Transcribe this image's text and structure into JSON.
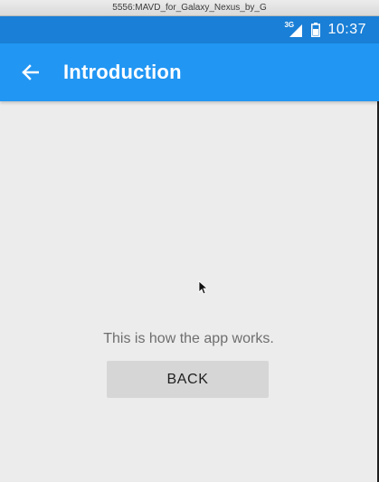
{
  "window": {
    "title": "5556:MAVD_for_Galaxy_Nexus_by_G"
  },
  "statusbar": {
    "network_label": "3G",
    "clock": "10:37",
    "icons": [
      "signal-icon",
      "battery-icon"
    ]
  },
  "appbar": {
    "title": "Introduction",
    "back_icon": "arrow-left-icon"
  },
  "content": {
    "message": "This is how the app works.",
    "button_label": "BACK"
  },
  "colors": {
    "statusbar": "#1a7fd6",
    "appbar": "#2196f3",
    "content_bg": "#ececec",
    "button_bg": "#d6d6d6"
  }
}
